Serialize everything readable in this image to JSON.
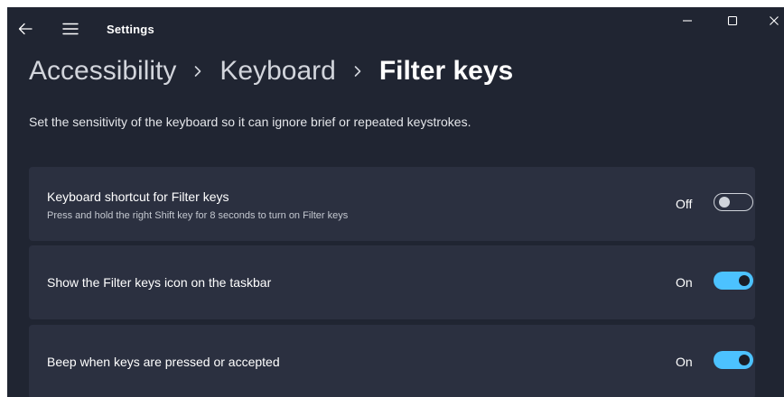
{
  "window": {
    "app_title": "Settings"
  },
  "breadcrumb": {
    "items": [
      "Accessibility",
      "Keyboard",
      "Filter keys"
    ]
  },
  "description": "Set the sensitivity of the keyboard so it can ignore brief or repeated keystrokes.",
  "settings": [
    {
      "title": "Keyboard shortcut for Filter keys",
      "subtitle": "Press and hold the right Shift key for 8 seconds to turn on Filter keys",
      "state_label": "Off",
      "enabled": false
    },
    {
      "title": "Show the Filter keys icon on the taskbar",
      "state_label": "On",
      "enabled": true
    },
    {
      "title": "Beep when keys are pressed or accepted",
      "state_label": "On",
      "enabled": true
    }
  ],
  "colors": {
    "background": "#202532",
    "card": "#2b3040",
    "accent": "#4cc2ff"
  },
  "icons": {
    "back": "back-arrow-icon",
    "menu": "hamburger-menu-icon",
    "minimize": "minimize-icon",
    "maximize": "maximize-icon",
    "close": "close-icon",
    "separator": "chevron-right-icon"
  }
}
